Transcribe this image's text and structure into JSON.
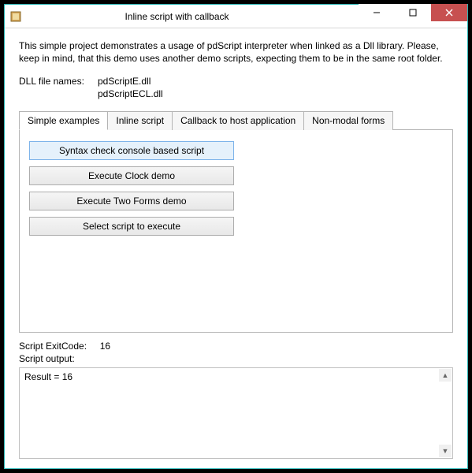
{
  "window": {
    "title": "Inline script with callback"
  },
  "intro": "This simple project demonstrates a usage of pdScript interpreter when linked as a Dll library. Please, keep in mind, that this demo uses another demo scripts, expecting them to be in the same root folder.",
  "dll": {
    "label": "DLL file names:",
    "values": [
      "pdScriptE.dll",
      "pdScriptECL.dll"
    ]
  },
  "tabs": [
    {
      "label": "Simple examples",
      "active": true
    },
    {
      "label": "Inline script",
      "active": false
    },
    {
      "label": "Callback to host application",
      "active": false
    },
    {
      "label": "Non-modal forms",
      "active": false
    }
  ],
  "buttons": {
    "syntax": "Syntax check console based script",
    "clock": "Execute Clock demo",
    "twoforms": "Execute Two Forms demo",
    "select": "Select script to execute"
  },
  "status": {
    "exitcode_label": "Script ExitCode:",
    "exitcode_value": "16",
    "output_label": "Script output:",
    "output_value": "Result = 16"
  }
}
